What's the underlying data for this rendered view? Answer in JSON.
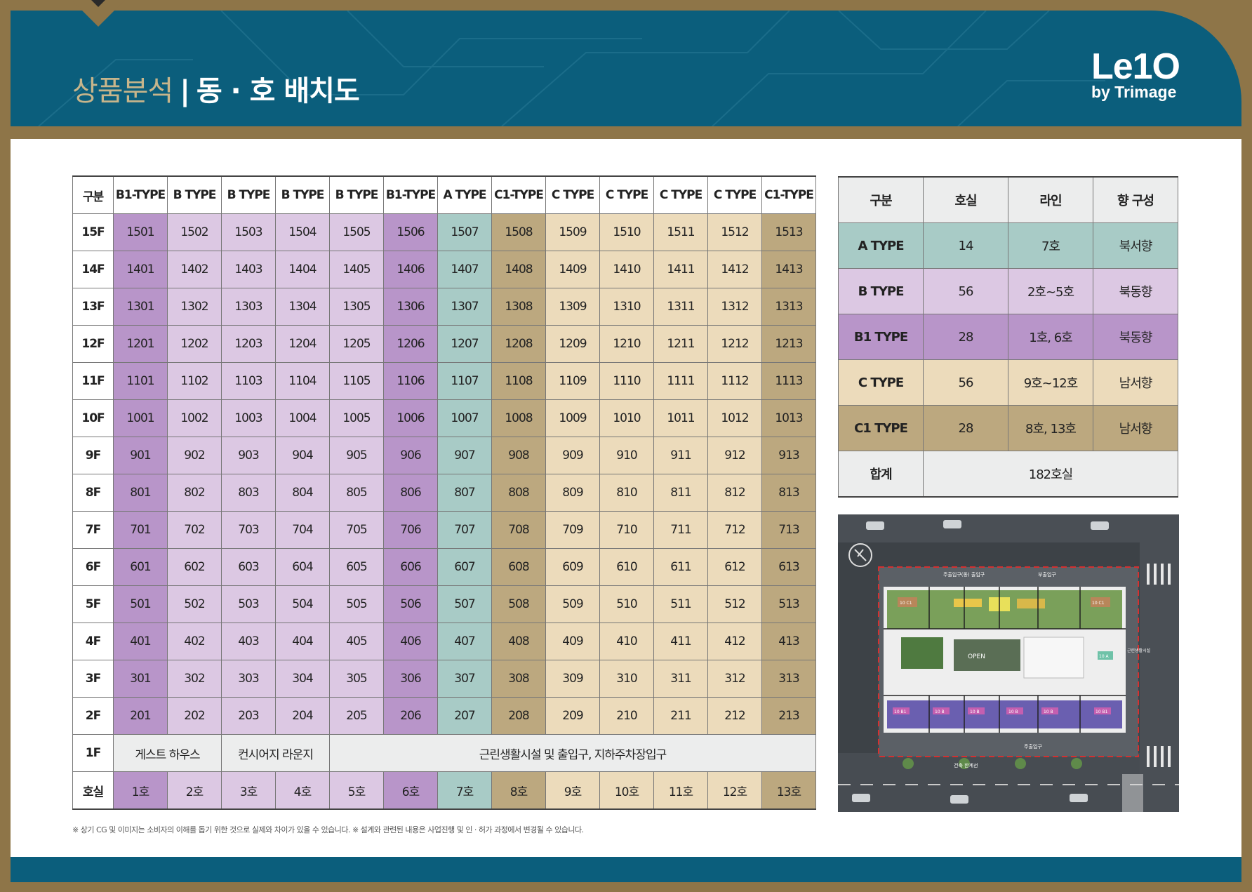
{
  "header": {
    "title_section": "상품분석",
    "title_separator": "|",
    "title_main": "동 · 호 배치도",
    "logo_line1": "Le1O",
    "logo_line2": "by Trimage"
  },
  "colors": {
    "B1-TYPE": "#b895c9",
    "B TYPE": "#dcc8e3",
    "A TYPE": "#a8cbc6",
    "C1-TYPE": "#bca87f",
    "C TYPE": "#ecdbbb",
    "header": "#0b5e7c",
    "frame": "#8e7548"
  },
  "layout_table": {
    "corner": "구분",
    "columns": [
      {
        "label": "B1-TYPE",
        "cls": "c-b1"
      },
      {
        "label": "B TYPE",
        "cls": "c-b"
      },
      {
        "label": "B TYPE",
        "cls": "c-b"
      },
      {
        "label": "B TYPE",
        "cls": "c-b"
      },
      {
        "label": "B TYPE",
        "cls": "c-b"
      },
      {
        "label": "B1-TYPE",
        "cls": "c-b1"
      },
      {
        "label": "A TYPE",
        "cls": "c-a"
      },
      {
        "label": "C1-TYPE",
        "cls": "c-c1"
      },
      {
        "label": "C TYPE",
        "cls": "c-c"
      },
      {
        "label": "C TYPE",
        "cls": "c-c"
      },
      {
        "label": "C TYPE",
        "cls": "c-c"
      },
      {
        "label": "C TYPE",
        "cls": "c-c"
      },
      {
        "label": "C1-TYPE",
        "cls": "c-c1"
      }
    ],
    "floors": [
      {
        "floor": "15F",
        "units": [
          "1501",
          "1502",
          "1503",
          "1504",
          "1505",
          "1506",
          "1507",
          "1508",
          "1509",
          "1510",
          "1511",
          "1512",
          "1513"
        ]
      },
      {
        "floor": "14F",
        "units": [
          "1401",
          "1402",
          "1403",
          "1404",
          "1405",
          "1406",
          "1407",
          "1408",
          "1409",
          "1410",
          "1411",
          "1412",
          "1413"
        ]
      },
      {
        "floor": "13F",
        "units": [
          "1301",
          "1302",
          "1303",
          "1304",
          "1305",
          "1306",
          "1307",
          "1308",
          "1309",
          "1310",
          "1311",
          "1312",
          "1313"
        ]
      },
      {
        "floor": "12F",
        "units": [
          "1201",
          "1202",
          "1203",
          "1204",
          "1205",
          "1206",
          "1207",
          "1208",
          "1209",
          "1210",
          "1211",
          "1212",
          "1213"
        ]
      },
      {
        "floor": "11F",
        "units": [
          "1101",
          "1102",
          "1103",
          "1104",
          "1105",
          "1106",
          "1107",
          "1108",
          "1109",
          "1110",
          "1111",
          "1112",
          "1113"
        ]
      },
      {
        "floor": "10F",
        "units": [
          "1001",
          "1002",
          "1003",
          "1004",
          "1005",
          "1006",
          "1007",
          "1008",
          "1009",
          "1010",
          "1011",
          "1012",
          "1013"
        ]
      },
      {
        "floor": "9F",
        "units": [
          "901",
          "902",
          "903",
          "904",
          "905",
          "906",
          "907",
          "908",
          "909",
          "910",
          "911",
          "912",
          "913"
        ]
      },
      {
        "floor": "8F",
        "units": [
          "801",
          "802",
          "803",
          "804",
          "805",
          "806",
          "807",
          "808",
          "809",
          "810",
          "811",
          "812",
          "813"
        ]
      },
      {
        "floor": "7F",
        "units": [
          "701",
          "702",
          "703",
          "704",
          "705",
          "706",
          "707",
          "708",
          "709",
          "710",
          "711",
          "712",
          "713"
        ]
      },
      {
        "floor": "6F",
        "units": [
          "601",
          "602",
          "603",
          "604",
          "605",
          "606",
          "607",
          "608",
          "609",
          "610",
          "611",
          "612",
          "613"
        ]
      },
      {
        "floor": "5F",
        "units": [
          "501",
          "502",
          "503",
          "504",
          "505",
          "506",
          "507",
          "508",
          "509",
          "510",
          "511",
          "512",
          "513"
        ]
      },
      {
        "floor": "4F",
        "units": [
          "401",
          "402",
          "403",
          "404",
          "405",
          "406",
          "407",
          "408",
          "409",
          "410",
          "411",
          "412",
          "413"
        ]
      },
      {
        "floor": "3F",
        "units": [
          "301",
          "302",
          "303",
          "304",
          "305",
          "306",
          "307",
          "308",
          "309",
          "310",
          "311",
          "312",
          "313"
        ]
      },
      {
        "floor": "2F",
        "units": [
          "201",
          "202",
          "203",
          "204",
          "205",
          "206",
          "207",
          "208",
          "209",
          "210",
          "211",
          "212",
          "213"
        ]
      }
    ],
    "first_floor": {
      "floor": "1F",
      "guest_house": "게스트 하우스",
      "concierge": "컨시어지 라운지",
      "retail": "근린생활시설 및 출입구, 지하주차장입구"
    },
    "line_row": {
      "label": "호실",
      "lines": [
        "1호",
        "2호",
        "3호",
        "4호",
        "5호",
        "6호",
        "7호",
        "8호",
        "9호",
        "10호",
        "11호",
        "12호",
        "13호"
      ]
    }
  },
  "summary_table": {
    "headers": [
      "구분",
      "호실",
      "라인",
      "향 구성"
    ],
    "rows": [
      {
        "type": "A TYPE",
        "count": "14",
        "line": "7호",
        "direction": "북서향",
        "cls": "c-a"
      },
      {
        "type": "B TYPE",
        "count": "56",
        "line": "2호~5호",
        "direction": "북동향",
        "cls": "c-b"
      },
      {
        "type": "B1 TYPE",
        "count": "28",
        "line": "1호, 6호",
        "direction": "북동향",
        "cls": "c-b1"
      },
      {
        "type": "C TYPE",
        "count": "56",
        "line": "9호~12호",
        "direction": "남서향",
        "cls": "c-c"
      },
      {
        "type": "C1 TYPE",
        "count": "28",
        "line": "8호, 13호",
        "direction": "남서향",
        "cls": "c-c1"
      }
    ],
    "total_label": "합계",
    "total_value": "182호실"
  },
  "site_plan": {
    "labels": {
      "top_left": "주출입구(동) 출입구",
      "top_right": "부출입구",
      "open": "OPEN",
      "right_side": "근린생활시설",
      "bottom_entry": "주출입구",
      "road": "건축 한계선"
    },
    "unit_tags_top": [
      "10 C1",
      "10 C1"
    ],
    "unit_tags_bottom": [
      "10 B1",
      "10 B",
      "10 B",
      "10 B",
      "10 B",
      "10 B1"
    ],
    "unit_tag_mid": "10 A"
  },
  "footnote": "※ 상기 CG 및 이미지는 소비자의 이해를 돕기 위한 것으로 실제와 차이가 있을 수 있습니다.  ※ 설계와 관련된 내용은 사업진행 및 인 · 허가 과정에서 변경될 수 있습니다."
}
